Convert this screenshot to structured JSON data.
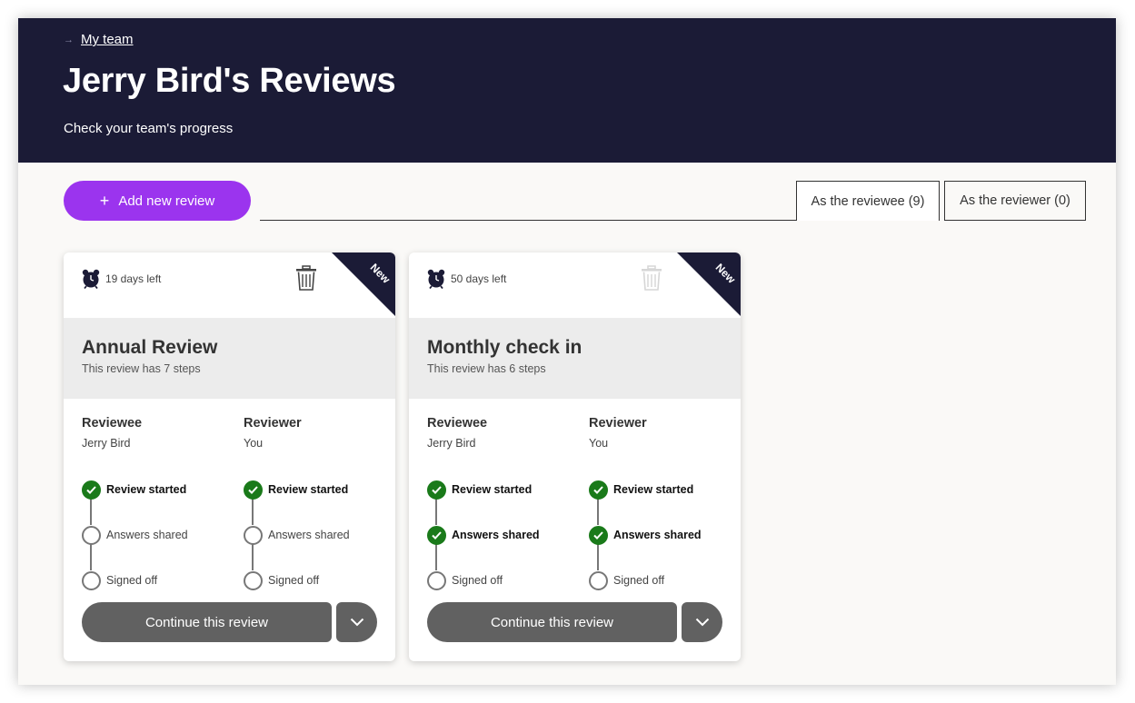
{
  "header": {
    "breadcrumb": "My team",
    "title": "Jerry Bird's Reviews",
    "subtitle": "Check your team's progress"
  },
  "toolbar": {
    "add_label": "Add new review",
    "tabs": [
      {
        "label": "As the reviewee (9)",
        "active": true
      },
      {
        "label": "As the reviewer (0)",
        "active": false
      }
    ]
  },
  "colors": {
    "header_bg": "#1b1b36",
    "accent": "#9b34ee",
    "done": "#1a7a1a",
    "button": "#616161"
  },
  "cards": [
    {
      "badge": "New",
      "due": "19 days left",
      "title": "Annual Review",
      "steps_text": "This review has 7 steps",
      "reviewee": {
        "heading": "Reviewee",
        "name": "Jerry Bird",
        "steps": [
          {
            "label": "Review started",
            "done": true
          },
          {
            "label": "Answers shared",
            "done": false
          },
          {
            "label": "Signed off",
            "done": false
          }
        ]
      },
      "reviewer": {
        "heading": "Reviewer",
        "name": "You",
        "steps": [
          {
            "label": "Review started",
            "done": true
          },
          {
            "label": "Answers shared",
            "done": false
          },
          {
            "label": "Signed off",
            "done": false
          }
        ]
      },
      "continue_label": "Continue this review",
      "delete_enabled": true
    },
    {
      "badge": "New",
      "due": "50 days left",
      "title": "Monthly check in",
      "steps_text": "This review has 6 steps",
      "reviewee": {
        "heading": "Reviewee",
        "name": "Jerry Bird",
        "steps": [
          {
            "label": "Review started",
            "done": true
          },
          {
            "label": "Answers shared",
            "done": true
          },
          {
            "label": "Signed off",
            "done": false
          }
        ]
      },
      "reviewer": {
        "heading": "Reviewer",
        "name": "You",
        "steps": [
          {
            "label": "Review started",
            "done": true
          },
          {
            "label": "Answers shared",
            "done": true
          },
          {
            "label": "Signed off",
            "done": false
          }
        ]
      },
      "continue_label": "Continue this review",
      "delete_enabled": false
    }
  ]
}
